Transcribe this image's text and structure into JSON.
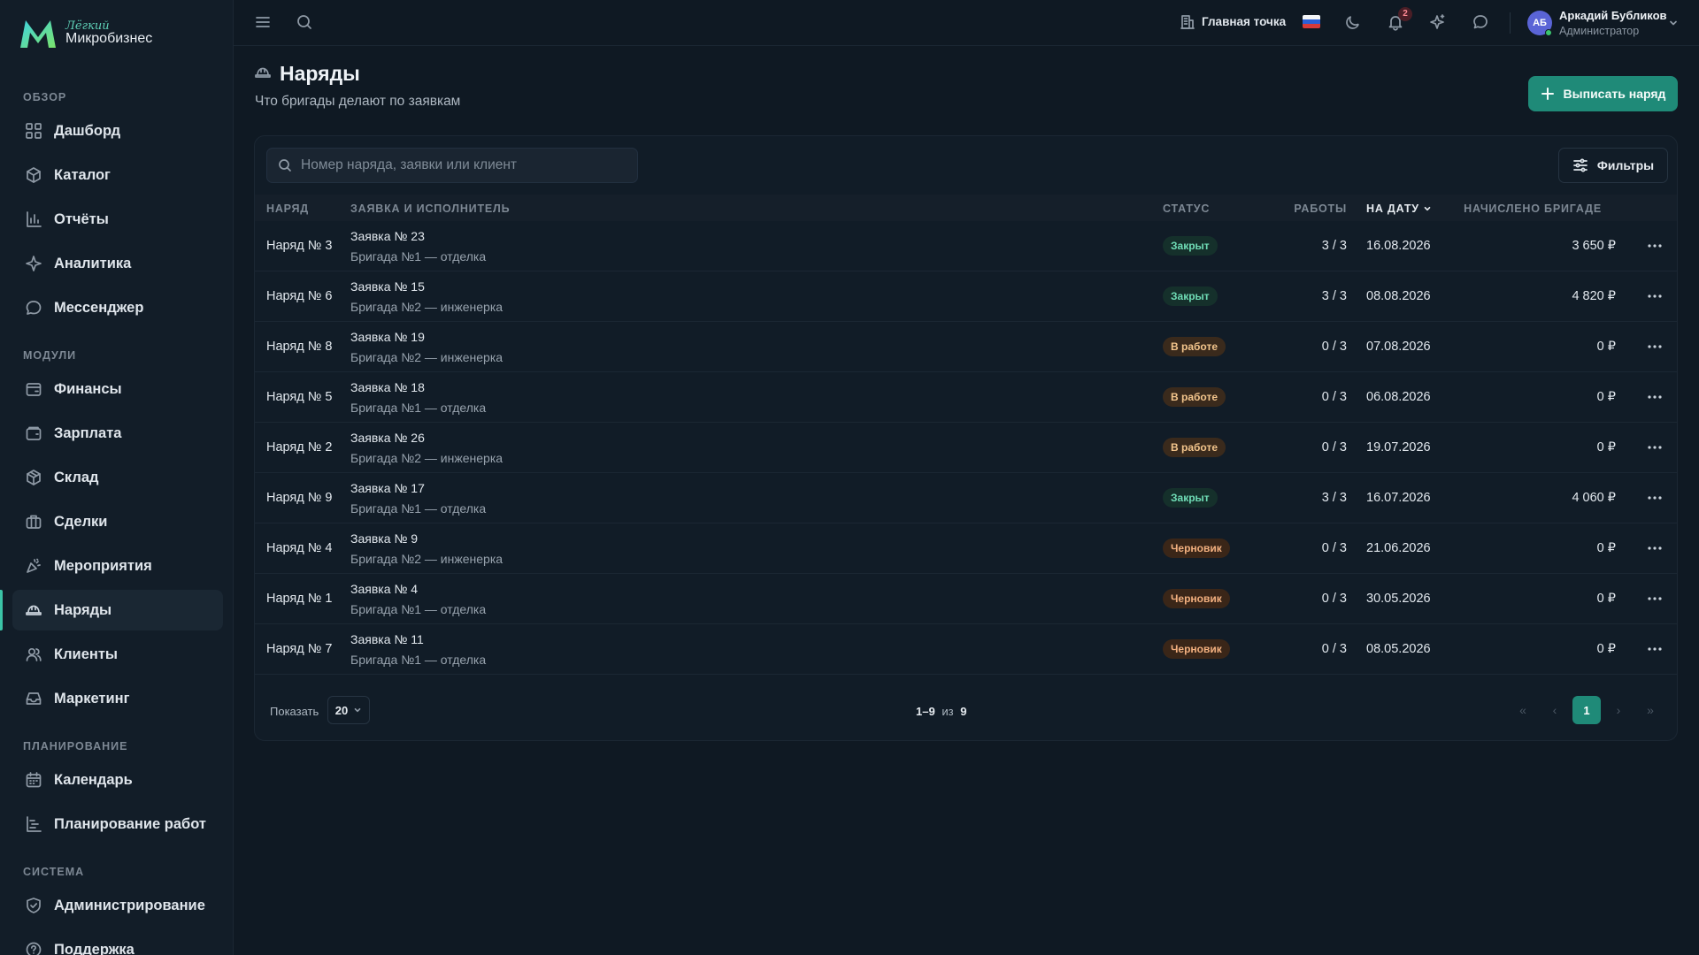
{
  "brand": {
    "top": "Лёгкий",
    "bottom": "Микробизнес"
  },
  "sidebar": {
    "sections": [
      {
        "title": "ОБЗОР",
        "items": [
          {
            "label": "Дашборд",
            "icon": "dashboard-icon"
          },
          {
            "label": "Каталог",
            "icon": "catalog-icon"
          },
          {
            "label": "Отчёты",
            "icon": "reports-icon"
          },
          {
            "label": "Аналитика",
            "icon": "analytics-icon"
          },
          {
            "label": "Мессенджер",
            "icon": "messenger-icon"
          }
        ]
      },
      {
        "title": "МОДУЛИ",
        "items": [
          {
            "label": "Финансы",
            "icon": "finance-icon"
          },
          {
            "label": "Зарплата",
            "icon": "salary-icon"
          },
          {
            "label": "Склад",
            "icon": "warehouse-icon"
          },
          {
            "label": "Сделки",
            "icon": "deals-icon"
          },
          {
            "label": "Мероприятия",
            "icon": "events-icon"
          },
          {
            "label": "Наряды",
            "icon": "hardhat-icon",
            "active": true
          },
          {
            "label": "Клиенты",
            "icon": "clients-icon"
          },
          {
            "label": "Маркетинг",
            "icon": "marketing-icon"
          }
        ]
      },
      {
        "title": "ПЛАНИРОВАНИЕ",
        "items": [
          {
            "label": "Календарь",
            "icon": "calendar-icon"
          },
          {
            "label": "Планирование работ",
            "icon": "planning-icon"
          }
        ]
      },
      {
        "title": "СИСТЕМА",
        "items": [
          {
            "label": "Администрирование",
            "icon": "admin-icon"
          },
          {
            "label": "Поддержка",
            "icon": "support-icon"
          }
        ]
      }
    ]
  },
  "topbar": {
    "location_label": "Главная точка",
    "notifications_count": "2",
    "user": {
      "initials": "АБ",
      "name": "Аркадий Бубликов",
      "role": "Администратор"
    }
  },
  "page": {
    "title": "Наряды",
    "subtitle": "Что бригады делают по заявкам",
    "primary_action": "Выписать наряд"
  },
  "table": {
    "search_placeholder": "Номер наряда, заявки или клиент",
    "filters_label": "Фильтры",
    "columns": {
      "order": "НАРЯД",
      "request": "ЗАЯВКА И ИСПОЛНИТЕЛЬ",
      "status": "СТАТУС",
      "works": "РАБОТЫ",
      "date": "НА ДАТУ",
      "amount": "НАЧИСЛЕНО БРИГАДЕ"
    },
    "rows": [
      {
        "order": "Наряд № 3",
        "request": "Заявка № 23",
        "team": "Бригада №1 — отделка",
        "status": "Закрыт",
        "status_kind": "closed",
        "works": "3 / 3",
        "date": "16.08.2026",
        "amount": "3 650 ₽"
      },
      {
        "order": "Наряд № 6",
        "request": "Заявка № 15",
        "team": "Бригада №2 — инженерка",
        "status": "Закрыт",
        "status_kind": "closed",
        "works": "3 / 3",
        "date": "08.08.2026",
        "amount": "4 820 ₽"
      },
      {
        "order": "Наряд № 8",
        "request": "Заявка № 19",
        "team": "Бригада №2 — инженерка",
        "status": "В работе",
        "status_kind": "work",
        "works": "0 / 3",
        "date": "07.08.2026",
        "amount": "0 ₽"
      },
      {
        "order": "Наряд № 5",
        "request": "Заявка № 18",
        "team": "Бригада №1 — отделка",
        "status": "В работе",
        "status_kind": "work",
        "works": "0 / 3",
        "date": "06.08.2026",
        "amount": "0 ₽"
      },
      {
        "order": "Наряд № 2",
        "request": "Заявка № 26",
        "team": "Бригада №2 — инженерка",
        "status": "В работе",
        "status_kind": "work",
        "works": "0 / 3",
        "date": "19.07.2026",
        "amount": "0 ₽"
      },
      {
        "order": "Наряд № 9",
        "request": "Заявка № 17",
        "team": "Бригада №1 — отделка",
        "status": "Закрыт",
        "status_kind": "closed",
        "works": "3 / 3",
        "date": "16.07.2026",
        "amount": "4 060 ₽"
      },
      {
        "order": "Наряд № 4",
        "request": "Заявка № 9",
        "team": "Бригада №2 — инженерка",
        "status": "Черновик",
        "status_kind": "draft",
        "works": "0 / 3",
        "date": "21.06.2026",
        "amount": "0 ₽"
      },
      {
        "order": "Наряд № 1",
        "request": "Заявка № 4",
        "team": "Бригада №1 — отделка",
        "status": "Черновик",
        "status_kind": "draft",
        "works": "0 / 3",
        "date": "30.05.2026",
        "amount": "0 ₽"
      },
      {
        "order": "Наряд № 7",
        "request": "Заявка № 11",
        "team": "Бригада №1 — отделка",
        "status": "Черновик",
        "status_kind": "draft",
        "works": "0 / 3",
        "date": "08.05.2026",
        "amount": "0 ₽"
      }
    ],
    "footer": {
      "show_label": "Показать",
      "page_size": "20",
      "range": "1–9",
      "of": "из",
      "total": "9",
      "current_page": "1"
    }
  },
  "colors": {
    "accent": "#1f8a78",
    "background": "#0f1923",
    "sidebar": "#121d28"
  }
}
